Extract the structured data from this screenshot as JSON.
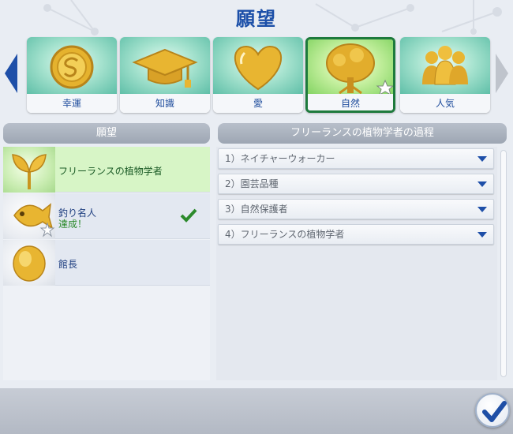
{
  "title": "願望",
  "categories": [
    {
      "label": "幸運",
      "icon": "gold-coin-icon",
      "selected": false
    },
    {
      "label": "知識",
      "icon": "graduation-cap-icon",
      "selected": false
    },
    {
      "label": "愛",
      "icon": "heart-icon",
      "selected": false
    },
    {
      "label": "自然",
      "icon": "tree-icon",
      "selected": true
    },
    {
      "label": "人気",
      "icon": "people-group-icon",
      "selected": false
    }
  ],
  "aspirations_panel": {
    "header": "願望",
    "items": [
      {
        "name": "フリーランスの植物学者",
        "icon": "sprout-icon",
        "selected": true,
        "status": ""
      },
      {
        "name": "釣り名人",
        "icon": "fish-icon",
        "selected": false,
        "status": "達成！"
      },
      {
        "name": "館長",
        "icon": "crystal-icon",
        "selected": false,
        "status": ""
      }
    ]
  },
  "milestones_panel": {
    "header": "フリーランスの植物学者の過程",
    "items": [
      "1）ネイチャーウォーカー",
      "2）園芸品種",
      "3）自然保護者",
      "4）フリーランスの植物学者"
    ]
  },
  "colors": {
    "title": "#1b4fa8",
    "selected_border": "#1d7a3c",
    "check": "#2c8a2c",
    "confirm": "#1f4fa6"
  }
}
